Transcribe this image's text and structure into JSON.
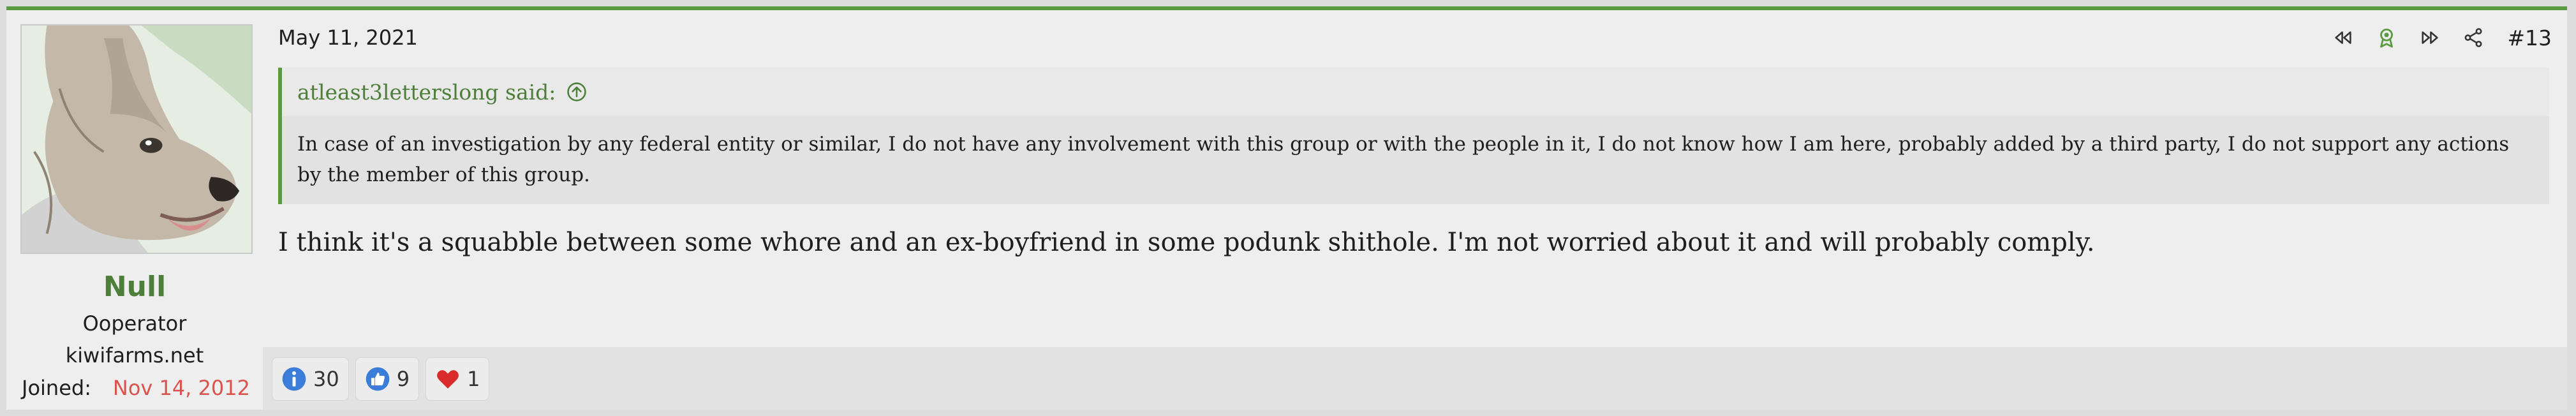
{
  "post": {
    "date": "May 11, 2021",
    "permalink": "#13",
    "actions": [
      {
        "icon": "rewind-icon"
      },
      {
        "icon": "award-ribbon-icon"
      },
      {
        "icon": "fast-forward-icon"
      },
      {
        "icon": "share-icon"
      }
    ],
    "user": {
      "name": "Null",
      "title_line1": "Ooperator",
      "title_line2": "kiwifarms.net",
      "joined_label": "Joined:",
      "joined_value": "Nov 14, 2012",
      "avatar_icon": "dog-avatar-icon"
    },
    "quote": {
      "author": "atleast3letterslong said:",
      "text": "In case of an investigation by any federal entity or similar, I do not have any involvement with this group or with the people in it, I do not know how I am here, probably added by a third party, I do not support any actions by the member of this group."
    },
    "message": "I think it's a squabble between some whore and an ex-boyfriend in some podunk shithole. I'm not worried about it and will probably comply.",
    "reactions": [
      {
        "icon": "informative-icon",
        "count": "30"
      },
      {
        "icon": "thumbs-up-icon",
        "count": "9"
      },
      {
        "icon": "heart-icon",
        "count": "1"
      }
    ],
    "colors": {
      "accent_green": "#4d7f3a",
      "border_green": "#5a9a40",
      "joined_red": "#d9534f"
    }
  }
}
